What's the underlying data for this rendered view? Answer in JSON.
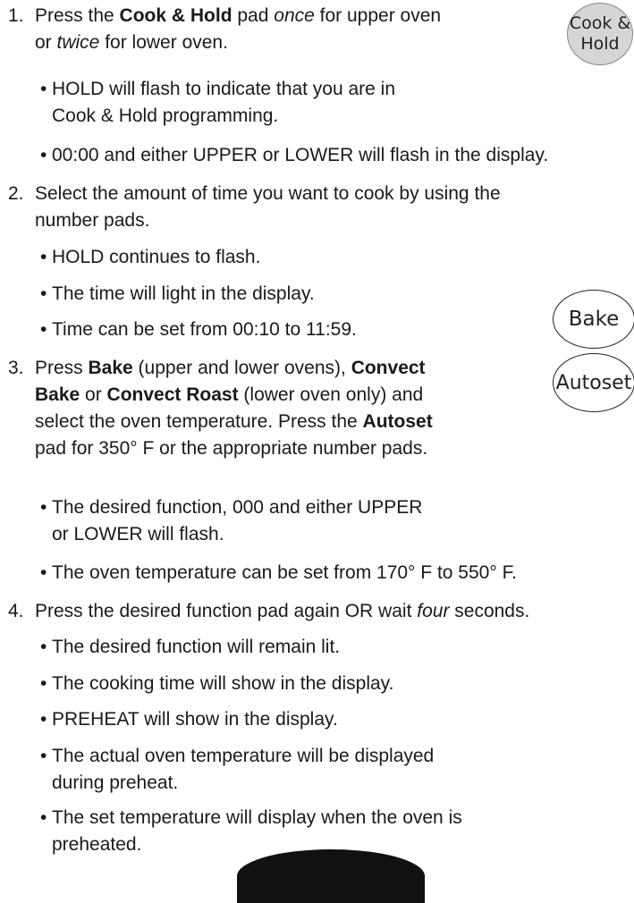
{
  "steps": [
    {
      "num": "1.",
      "a": "Press the ",
      "b": "Cook & Hold",
      "c": " pad ",
      "d": "once",
      "e": " for upper oven",
      "f": "or ",
      "g": "twice",
      "h": " for lower oven."
    },
    {
      "num": "2.",
      "line1": "Select the amount of time you want to cook by using the",
      "line2": "number pads."
    },
    {
      "num": "3.",
      "a": "Press ",
      "b": "Bake",
      "c": " (upper and lower ovens), ",
      "d": "Convect",
      "e": "Bake",
      "f": " or ",
      "g": "Convect Roast",
      "h": " (lower oven only) and",
      "i": "select the oven temperature. Press the ",
      "j": "Autoset",
      "k": "pad for 350° F or the appropriate number pads."
    },
    {
      "num": "4.",
      "a": "Press the desired function pad again OR wait ",
      "b": "four",
      "c": " seconds."
    }
  ],
  "bullets": {
    "s1": [
      [
        "HOLD will flash to indicate that you are in",
        "Cook & Hold programming."
      ],
      [
        "00:00 and either UPPER or LOWER will flash in the display."
      ]
    ],
    "s2": [
      [
        "HOLD continues to flash."
      ],
      [
        "The time will light in the display."
      ],
      [
        "Time can be set from 00:10 to 11:59."
      ]
    ],
    "s3": [
      [
        "The desired function, 000 and either UPPER",
        "or LOWER will flash."
      ],
      [
        "The oven temperature can be set from 170° F to 550° F."
      ]
    ],
    "s4": [
      [
        "The desired function will remain lit."
      ],
      [
        "The cooking time will show in the display."
      ],
      [
        "PREHEAT will show in the display."
      ],
      [
        "The actual oven temperature will be displayed",
        "during preheat."
      ],
      [
        "The set temperature will display when the oven is",
        "preheated."
      ]
    ]
  },
  "bullet_char": "•",
  "pads": {
    "cook_hold": [
      "Cook &",
      "Hold"
    ],
    "bake": "Bake",
    "autoset": "Autoset"
  }
}
